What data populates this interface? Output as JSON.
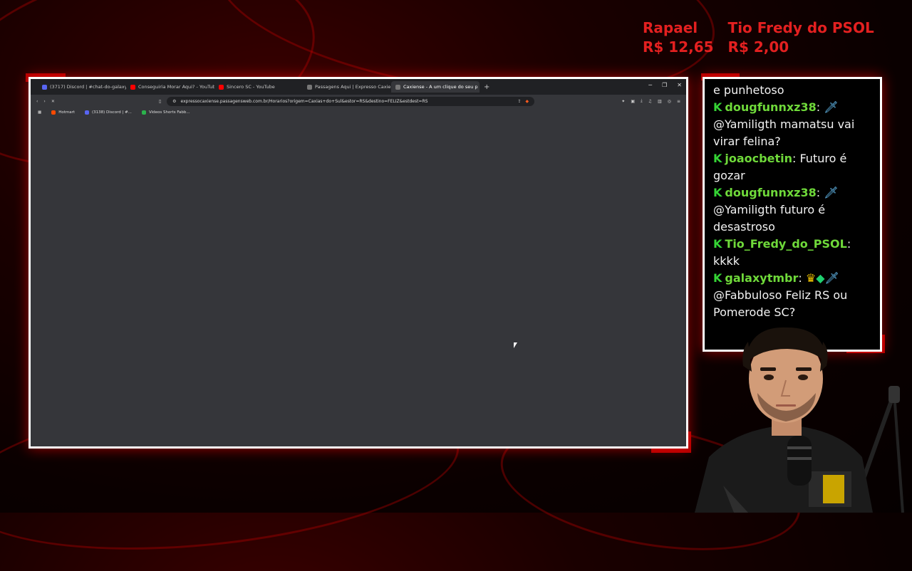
{
  "donations": [
    {
      "name": "Rapael",
      "amount": "R$ 12,65"
    },
    {
      "name": "Tio Fredy do PSOL",
      "amount": "R$ 2,00"
    }
  ],
  "browser": {
    "tabs": [
      {
        "label": "(3717) Discord | #chat-do-galaxy | El",
        "color": "#5865f2"
      },
      {
        "label": "Conseguiria Morar Aqui? - YouTube",
        "color": "#ff0000"
      },
      {
        "label": "Sincero SC - YouTube",
        "color": "#ff0000"
      },
      {
        "label": "Passagens Aqui | Expresso Caxiense",
        "color": "#777777"
      },
      {
        "label": "Caxiense - A um clique do seu p",
        "color": "#777777",
        "active": true
      }
    ],
    "new_tab": "+",
    "url": "expressocaxiense.passagensweb.com.br/Horarios?origem=Caxias+do+Sul&estor=RS&destino=FELIZ&estdest=RS",
    "bookmarks": [
      {
        "label": "Hotmart",
        "color": "#ff4a00"
      },
      {
        "label": "(3138) Discord | #...",
        "color": "#5865f2"
      },
      {
        "label": "Videos Shorts Fabb...",
        "color": "#2bb24c"
      }
    ]
  },
  "chat": {
    "messages": [
      {
        "user": "",
        "text": "e punhetoso"
      },
      {
        "user": "dougfunnxz38",
        "text": "@Yamiligth mamatsu vai virar felina?",
        "badges": "sword"
      },
      {
        "user": "joaocbetin",
        "text": "Futuro é gozar"
      },
      {
        "user": "dougfunnxz38",
        "text": "@Yamiligth futuro é desastroso",
        "badges": "sword"
      },
      {
        "user": "Tio_Fredy_do_PSOL",
        "text": "kkkk"
      },
      {
        "user": "galaxytmbr",
        "text": "@Fabbuloso Feliz RS ou Pomerode SC?",
        "badges": "crown-diamond-sword"
      }
    ]
  },
  "colors": {
    "accent_red": "#e32020",
    "chat_user": "#6fd93a",
    "background": "#1a0000"
  }
}
